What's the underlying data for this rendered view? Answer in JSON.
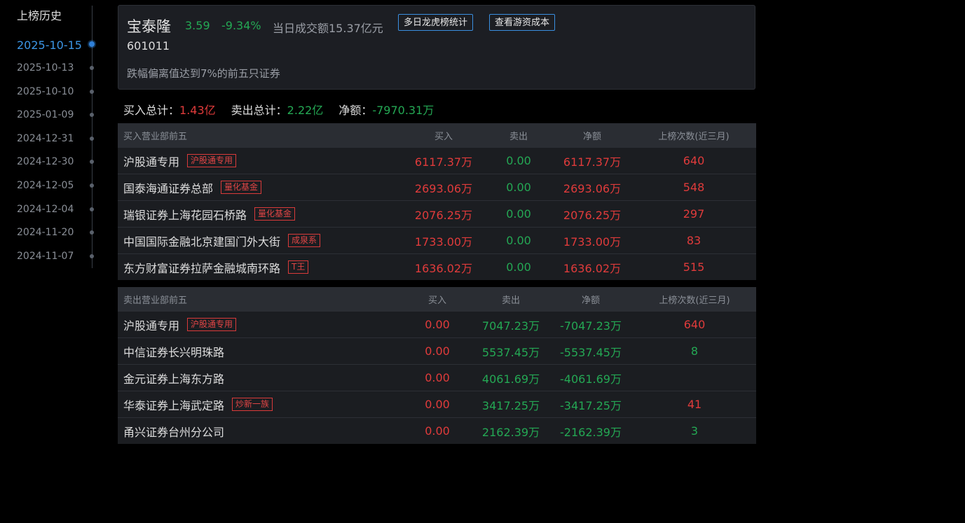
{
  "history": {
    "title": "上榜历史",
    "dates": [
      "2025-10-15",
      "2025-10-13",
      "2025-10-10",
      "2025-01-09",
      "2024-12-31",
      "2024-12-30",
      "2024-12-05",
      "2024-12-04",
      "2024-11-20",
      "2024-11-07"
    ],
    "active_index": 0
  },
  "stock": {
    "name": "宝泰隆",
    "price": "3.59",
    "change": "-9.34%",
    "turnover": "当日成交额15.37亿元",
    "code": "601011",
    "reason": "跌幅偏离值达到7%的前五只证券",
    "btn_multi": "多日龙虎榜统计",
    "btn_cost": "查看游资成本"
  },
  "totals": {
    "buy_label": "买入总计：",
    "buy_value": "1.43亿",
    "sell_label": "卖出总计：",
    "sell_value": "2.22亿",
    "net_label": "净额：",
    "net_value": "-7970.31万"
  },
  "buy_table": {
    "headers": {
      "name": "买入营业部前五",
      "buy": "买入",
      "sell": "卖出",
      "net": "净额",
      "count": "上榜次数(近三月)"
    },
    "rows": [
      {
        "name": "沪股通专用",
        "tag": "沪股通专用",
        "buy": "6117.37万",
        "sell": "0.00",
        "net": "6117.37万",
        "count": "640"
      },
      {
        "name": "国泰海通证券总部",
        "tag": "量化基金",
        "buy": "2693.06万",
        "sell": "0.00",
        "net": "2693.06万",
        "count": "548"
      },
      {
        "name": "瑞银证券上海花园石桥路",
        "tag": "量化基金",
        "buy": "2076.25万",
        "sell": "0.00",
        "net": "2076.25万",
        "count": "297"
      },
      {
        "name": "中国国际金融北京建国门外大街",
        "tag": "成泉系",
        "buy": "1733.00万",
        "sell": "0.00",
        "net": "1733.00万",
        "count": "83"
      },
      {
        "name": "东方财富证券拉萨金融城南环路",
        "tag": "T王",
        "buy": "1636.02万",
        "sell": "0.00",
        "net": "1636.02万",
        "count": "515"
      }
    ]
  },
  "sell_table": {
    "headers": {
      "name": "卖出营业部前五",
      "buy": "买入",
      "sell": "卖出",
      "net": "净额",
      "count": "上榜次数(近三月)"
    },
    "rows": [
      {
        "name": "沪股通专用",
        "tag": "沪股通专用",
        "buy": "0.00",
        "sell": "7047.23万",
        "net": "-7047.23万",
        "count": "640"
      },
      {
        "name": "中信证券长兴明珠路",
        "tag": "",
        "buy": "0.00",
        "sell": "5537.45万",
        "net": "-5537.45万",
        "count": "8"
      },
      {
        "name": "金元证券上海东方路",
        "tag": "",
        "buy": "0.00",
        "sell": "4061.69万",
        "net": "-4061.69万",
        "count": ""
      },
      {
        "name": "华泰证券上海武定路",
        "tag": "炒新一族",
        "buy": "0.00",
        "sell": "3417.25万",
        "net": "-3417.25万",
        "count": "41"
      },
      {
        "name": "甬兴证券台州分公司",
        "tag": "",
        "buy": "0.00",
        "sell": "2162.39万",
        "net": "-2162.39万",
        "count": "3"
      }
    ]
  },
  "colors": {
    "up": "#e03b3b",
    "down": "#24a854",
    "accent": "#3c96e6",
    "background": "#000000",
    "card": "#1c1e23"
  }
}
